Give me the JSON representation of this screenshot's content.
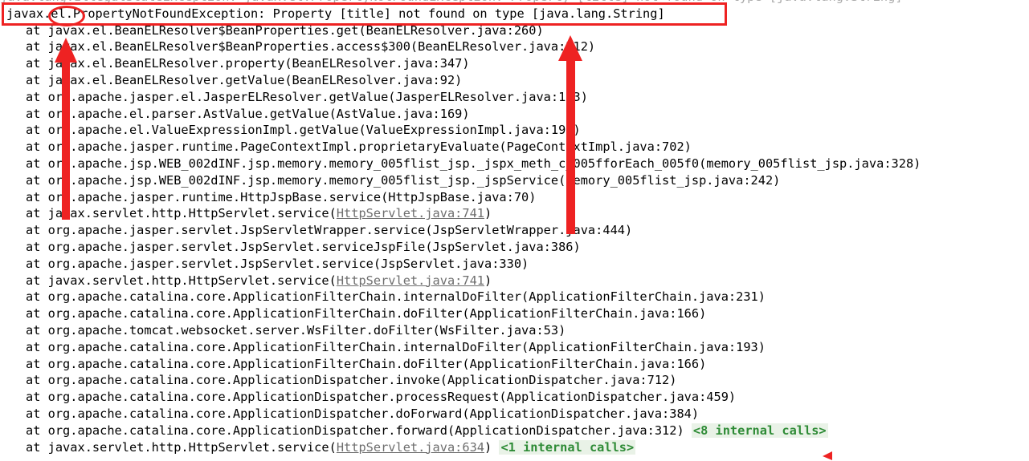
{
  "window": {
    "kind": "stack-trace-console",
    "background_color": "#ffffff",
    "text_color": "#000000",
    "link_color": "#6e6e6e",
    "annotation_color": "#ee2222",
    "internal_calls_color": "#2e8b36",
    "internal_calls_background": "#e9f2e7"
  },
  "trace": {
    "clipped_top_line": "java.lang.IllegalStateException: javax.el.PropertyNotFoundException: Property [title] not found on type [java.lang.String]",
    "exception_line": {
      "text": "javax.el.PropertyNotFoundException: Property [title] not found on type [java.lang.String]",
      "prefix": "javax",
      "highlighted_token": "el",
      "suffix": ".PropertyNotFoundException: Property [title] not found on type [java.lang.String]"
    },
    "frames": [
      {
        "indent": "at ",
        "text": "javax.el.BeanELResolver$BeanProperties.get(BeanELResolver.java:260)"
      },
      {
        "indent": "at ",
        "text": "javax.el.BeanELResolver$BeanProperties.access$300(BeanELResolver.java:212)"
      },
      {
        "indent": "at ",
        "text": "javax.el.BeanELResolver.property(BeanELResolver.java:347)"
      },
      {
        "indent": "at ",
        "text": "javax.el.BeanELResolver.getValue(BeanELResolver.java:92)"
      },
      {
        "indent": "at ",
        "text": "org.apache.jasper.el.JasperELResolver.getValue(JasperELResolver.java:113)"
      },
      {
        "indent": "at ",
        "text": "org.apache.el.parser.AstValue.getValue(AstValue.java:169)"
      },
      {
        "indent": "at ",
        "text": "org.apache.el.ValueExpressionImpl.getValue(ValueExpressionImpl.java:190)"
      },
      {
        "indent": "at ",
        "text": "org.apache.jasper.runtime.PageContextImpl.proprietaryEvaluate(PageContextImpl.java:702)"
      },
      {
        "indent": "at ",
        "text": "org.apache.jsp.WEB_002dINF.jsp.memory.memory_005flist_jsp._jspx_meth_c_005fforEach_005f0(memory_005flist_jsp.java:328)"
      },
      {
        "indent": "at ",
        "text": "org.apache.jsp.WEB_002dINF.jsp.memory.memory_005flist_jsp._jspService(memory_005flist_jsp.java:242)"
      },
      {
        "indent": "at ",
        "text": "org.apache.jasper.runtime.HttpJspBase.service(HttpJspBase.java:70)"
      },
      {
        "indent": "at ",
        "prefix": "javax.servlet.http.HttpServlet.service(",
        "link": "HttpServlet.java:741",
        "suffix": ")"
      },
      {
        "indent": "at ",
        "text": "org.apache.jasper.servlet.JspServletWrapper.service(JspServletWrapper.java:444)"
      },
      {
        "indent": "at ",
        "text": "org.apache.jasper.servlet.JspServlet.serviceJspFile(JspServlet.java:386)"
      },
      {
        "indent": "at ",
        "text": "org.apache.jasper.servlet.JspServlet.service(JspServlet.java:330)"
      },
      {
        "indent": "at ",
        "prefix": "javax.servlet.http.HttpServlet.service(",
        "link": "HttpServlet.java:741",
        "suffix": ")"
      },
      {
        "indent": "at ",
        "text": "org.apache.catalina.core.ApplicationFilterChain.internalDoFilter(ApplicationFilterChain.java:231)"
      },
      {
        "indent": "at ",
        "text": "org.apache.catalina.core.ApplicationFilterChain.doFilter(ApplicationFilterChain.java:166)"
      },
      {
        "indent": "at ",
        "text": "org.apache.tomcat.websocket.server.WsFilter.doFilter(WsFilter.java:53)"
      },
      {
        "indent": "at ",
        "text": "org.apache.catalina.core.ApplicationFilterChain.internalDoFilter(ApplicationFilterChain.java:193)"
      },
      {
        "indent": "at ",
        "text": "org.apache.catalina.core.ApplicationFilterChain.doFilter(ApplicationFilterChain.java:166)"
      },
      {
        "indent": "at ",
        "text": "org.apache.catalina.core.ApplicationDispatcher.invoke(ApplicationDispatcher.java:712)"
      },
      {
        "indent": "at ",
        "text": "org.apache.catalina.core.ApplicationDispatcher.processRequest(ApplicationDispatcher.java:459)"
      },
      {
        "indent": "at ",
        "text": "org.apache.catalina.core.ApplicationDispatcher.doForward(ApplicationDispatcher.java:384)"
      },
      {
        "indent": "at ",
        "text": "org.apache.catalina.core.ApplicationDispatcher.forward(ApplicationDispatcher.java:312) ",
        "badge": "<8 internal calls>"
      },
      {
        "indent": "at ",
        "prefix": "javax.servlet.http.HttpServlet.service(",
        "link": "HttpServlet.java:634",
        "suffix": ") ",
        "badge": "<1 internal calls>"
      }
    ]
  },
  "annotations": {
    "exception_box": {
      "label": "red-rectangle-around-exception-line"
    },
    "el_circle": {
      "label": "red-ellipse-around-el-package"
    },
    "left_arrow": {
      "label": "red-arrow-pointing-up-to-el-package"
    },
    "right_arrow": {
      "label": "red-arrow-pointing-up-to-line-260"
    },
    "bottom_arrowhead": {
      "label": "red-small-arrowhead-bottom-right"
    }
  }
}
